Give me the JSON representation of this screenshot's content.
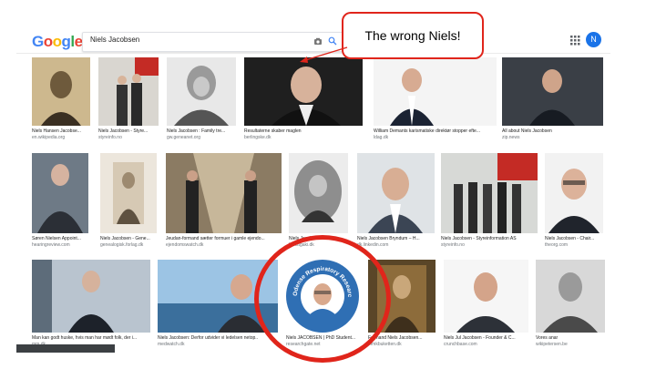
{
  "header": {
    "logo_text": "Google",
    "search_query": "Niels Jacobsen",
    "avatar_letter": "N"
  },
  "callout": {
    "text": "The wrong Niels!"
  },
  "results": [
    {
      "title": "Niels Hansen Jacobse...",
      "source": "en.wikipedia.org"
    },
    {
      "title": "Niels Jacobsen - Styre...",
      "source": "styreinfo.no"
    },
    {
      "title": "Niels Jacobsen : Family tre...",
      "source": "gw.geneanet.org"
    },
    {
      "title": "Resultaterne skaber maglen",
      "source": "berlingske.dk"
    },
    {
      "title": "William Demants karismatiske direktør stopper efte...",
      "source": "ldag.dk"
    },
    {
      "title": "All about Niels Jacobsen",
      "source": "zip.news"
    },
    {
      "title": "Søren Nielsen Appoint...",
      "source": "hearingreview.com"
    },
    {
      "title": "Niels Jacobsen - Gene...",
      "source": "genealogisk.forlag.dk"
    },
    {
      "title": "Jeudan-formand sætter formuer i gamle ejendo...",
      "source": "ejendomswatch.dk"
    },
    {
      "title": "Niels Jacobsen 1835...",
      "source": "kunstgaki.dk"
    },
    {
      "title": "Niels Jacobsen Bryndum – H...",
      "source": "dk.linkedin.com"
    },
    {
      "title": "Niels Jacobsen - Styreinformation AS",
      "source": "styreinfo.no"
    },
    {
      "title": "Niels Jacobsen - Chair...",
      "source": "theorg.com"
    },
    {
      "title": "Man kan godt huske, hvis man har mødt folk, der i...",
      "source": "mm.dk"
    },
    {
      "title": "Niels Jacobsen: Derfor udvider vi ledelsen netop...",
      "source": "medwatch.dk"
    },
    {
      "title": "Niels JACOBSEN | PhD Student...",
      "source": "researchgate.net"
    },
    {
      "title": "Formand Niels Jacobsen...",
      "source": "mmkbuketten.dk"
    },
    {
      "title": "Niels Jul Jacobsen - Founder & C...",
      "source": "crunchbase.com"
    },
    {
      "title": "Vores anar",
      "source": "wikipetersen.be"
    }
  ],
  "badge_text": "Odense Respiratory Research Unit",
  "colors": {
    "accent_red": "#e0251b",
    "google_blue": "#4285f4",
    "google_red": "#ea4335",
    "google_yellow": "#fbbc05",
    "google_green": "#34a853"
  }
}
